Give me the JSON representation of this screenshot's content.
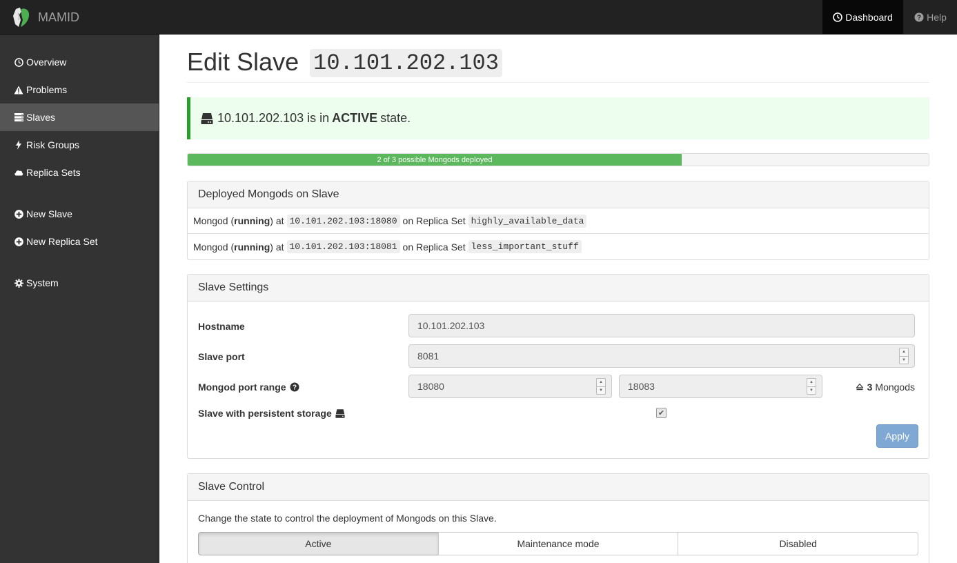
{
  "navbar": {
    "brand": "MAMID",
    "dashboard_label": "Dashboard",
    "help_label": "Help"
  },
  "sidebar": {
    "items": [
      {
        "label": "Overview",
        "icon": "dashboard-icon"
      },
      {
        "label": "Problems",
        "icon": "warning-icon"
      },
      {
        "label": "Slaves",
        "icon": "server-icon",
        "active": true
      },
      {
        "label": "Risk Groups",
        "icon": "flash-icon"
      },
      {
        "label": "Replica Sets",
        "icon": "cloud-icon"
      },
      {
        "label": "New Slave",
        "icon": "plus-circle-icon"
      },
      {
        "label": "New Replica Set",
        "icon": "plus-circle-icon"
      },
      {
        "label": "System",
        "icon": "cog-icon"
      }
    ]
  },
  "page": {
    "title_prefix": "Edit Slave",
    "title_host": "10.101.202.103"
  },
  "alert": {
    "host": "10.101.202.103",
    "text_mid": "is in",
    "state": "ACTIVE",
    "text_end": "state."
  },
  "progress": {
    "label": "2 of 3 possible Mongods deployed",
    "deployed": 2,
    "possible": 3
  },
  "deployed_panel": {
    "title": "Deployed Mongods on Slave",
    "rows": [
      {
        "prefix": "Mongod (",
        "status": "running",
        "mid": ") at",
        "address": "10.101.202.103:18080",
        "rs_label": "on Replica Set",
        "replica_set": "highly_available_data"
      },
      {
        "prefix": "Mongod (",
        "status": "running",
        "mid": ") at",
        "address": "10.101.202.103:18081",
        "rs_label": "on Replica Set",
        "replica_set": "less_important_stuff"
      }
    ]
  },
  "settings_panel": {
    "title": "Slave Settings",
    "hostname_label": "Hostname",
    "hostname_value": "10.101.202.103",
    "slave_port_label": "Slave port",
    "slave_port_value": "8081",
    "port_range_label": "Mongod port range",
    "port_range_from": "18080",
    "port_range_to": "18083",
    "mongods_count": "3",
    "mongods_label": "Mongods",
    "persistent_label": "Slave with persistent storage",
    "persistent_checked": true,
    "apply_label": "Apply"
  },
  "control_panel": {
    "title": "Slave Control",
    "description": "Change the state to control the deployment of Mongods on this Slave.",
    "states": [
      {
        "label": "Active",
        "active": true
      },
      {
        "label": "Maintenance mode",
        "active": false
      },
      {
        "label": "Disabled",
        "active": false
      }
    ]
  },
  "colors": {
    "navbar_bg": "#222222",
    "sidebar_bg": "#333333",
    "sidebar_active": "#555555",
    "progress_green": "#5cb85c",
    "alert_border": "#27a127",
    "apply_button": "#7fa8d4"
  }
}
